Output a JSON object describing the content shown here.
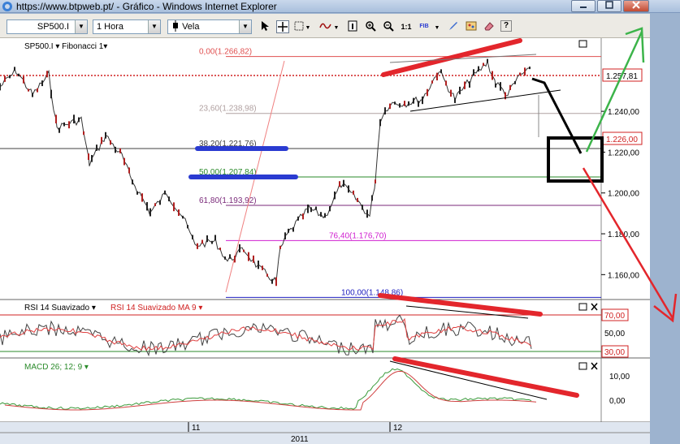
{
  "window": {
    "title": "https://www.btpweb.pt/ - Gráfico - Windows Internet Explorer",
    "controls": [
      "0",
      "1",
      "r"
    ]
  },
  "toolbar": {
    "symbol": "SP500.I",
    "timeframe": "1 Hora",
    "chart_style": "Vela",
    "tools": [
      "cursor",
      "crosshair",
      "grid",
      "wave",
      "brush",
      "info",
      "zoom-in",
      "zoom-out",
      "1:1",
      "FIB",
      "pen",
      "palette",
      "eraser",
      "help"
    ],
    "ratio_label": "1:1",
    "fib_label": "FIB",
    "help_label": "?"
  },
  "price_panel": {
    "legend": "SP500.I ▾  Fibonacci 1▾",
    "fib_levels": [
      {
        "label": "0,00(1.266,82)",
        "value": 1266.82,
        "color": "#e05050"
      },
      {
        "label": "23,60(1.238,98)",
        "value": 1238.98,
        "color": "#b0a0a0"
      },
      {
        "label": "38,20(1.221,76)",
        "value": 1221.76,
        "color": "#404040"
      },
      {
        "label": "50,00(1.207,84)",
        "value": 1207.84,
        "color": "#2a8a2a"
      },
      {
        "label": "61,80(1.193,92)",
        "value": 1193.92,
        "color": "#7a2a7a"
      },
      {
        "label": "76,40(1.176,70)",
        "value": 1176.7,
        "color": "#d020d0"
      },
      {
        "label": "100,00(1.148,86)",
        "value": 1148.86,
        "color": "#2020c0"
      }
    ],
    "axis_ticks": [
      "1.240,00",
      "1.220,00",
      "1.200,00",
      "1.180,00",
      "1.160,00"
    ],
    "tick_values": [
      1240,
      1220,
      1200,
      1180,
      1160
    ],
    "current_price": "1.257,81",
    "current_value": 1257.81,
    "marker_price": "1.226,00",
    "marker_value": 1226.0
  },
  "rsi_panel": {
    "legend_a": "RSI 14 Suavizado ▾",
    "legend_b": "RSI 14 Suavizado MA 9 ▾",
    "ticks": [
      "70,00",
      "50,00",
      "30,00"
    ]
  },
  "macd_panel": {
    "legend": "MACD 26; 12; 9 ▾",
    "ticks": [
      "10,00",
      "0,00"
    ]
  },
  "time_axis": {
    "days": [
      "11",
      "12"
    ],
    "year": "2011"
  },
  "colors": {
    "window_bg": "#9db3cf",
    "annotation_red": "#e3262c",
    "annotation_blue": "#2a3bd1",
    "annotation_green": "#3cb44a"
  }
}
